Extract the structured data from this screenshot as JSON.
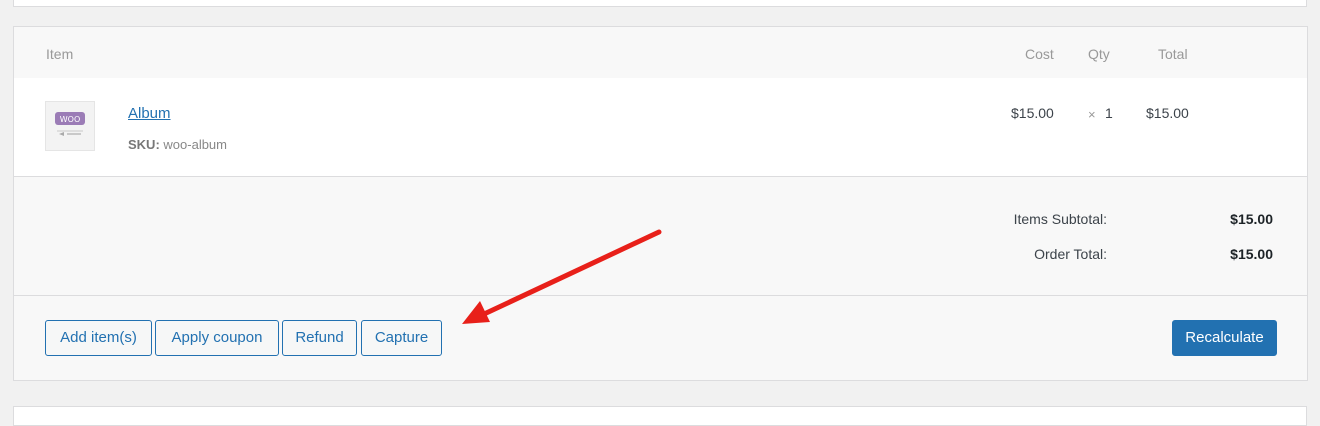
{
  "table": {
    "headers": {
      "item": "Item",
      "cost": "Cost",
      "qty": "Qty",
      "total": "Total"
    },
    "items": [
      {
        "name": "Album",
        "sku_label": "SKU:",
        "sku_value": "woo-album",
        "cost": "$15.00",
        "qty_sign": "×",
        "qty": "1",
        "total": "$15.00",
        "thumbnail_text": "WOO"
      }
    ]
  },
  "totals": {
    "subtotal_label": "Items Subtotal:",
    "subtotal_value": "$15.00",
    "order_total_label": "Order Total:",
    "order_total_value": "$15.00"
  },
  "actions": {
    "add_items": "Add item(s)",
    "apply_coupon": "Apply coupon",
    "refund": "Refund",
    "capture": "Capture",
    "recalculate": "Recalculate"
  },
  "colors": {
    "accent": "#2271b1",
    "annotation_arrow": "#e8201a"
  },
  "icons": {
    "annotation": "red-arrow-icon",
    "thumbnail": "woo-product-thumbnail-icon"
  }
}
